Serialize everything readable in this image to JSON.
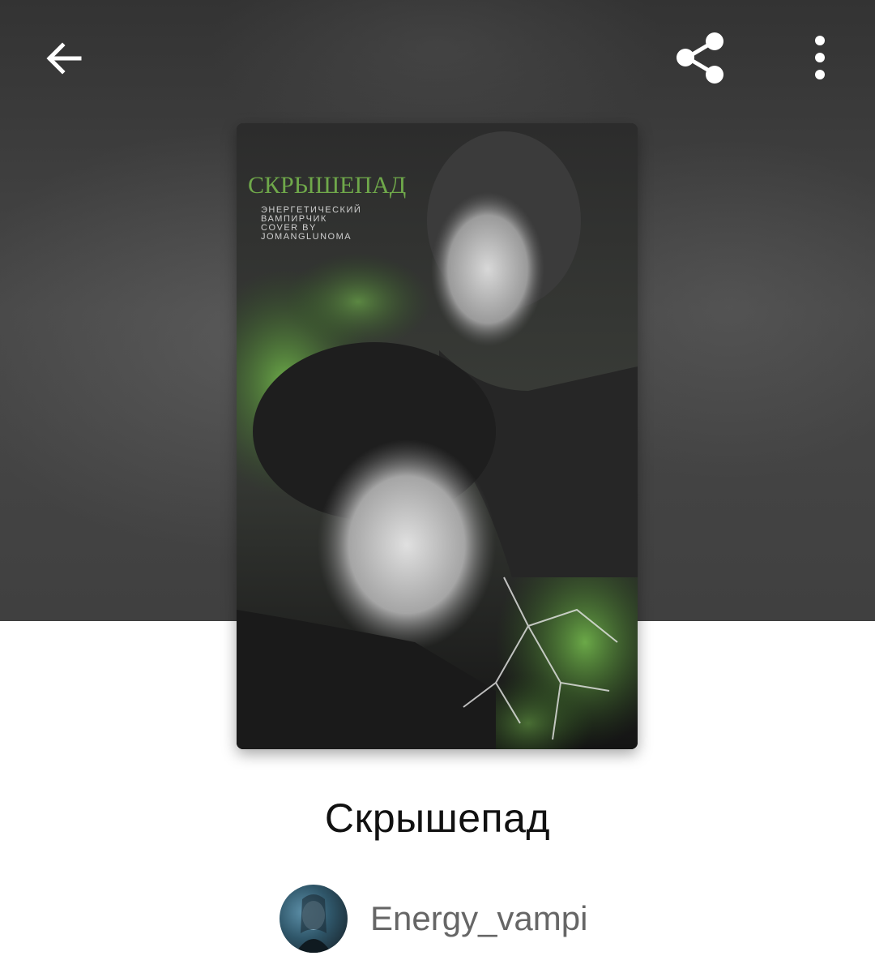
{
  "toolbar": {
    "back_icon": "arrow-left-icon",
    "share_icon": "share-icon",
    "more_icon": "more-vertical-icon"
  },
  "cover": {
    "title": "СКРЫШЕПАД",
    "lines": [
      "ЭНЕРГЕТИЧЕСКИЙ",
      "ВАМПИРЧИК",
      "COVER BY",
      "JOMANGLUNOMA"
    ],
    "accent_color": "#4f8a2f"
  },
  "book": {
    "title": "Скрышепад"
  },
  "author": {
    "name": "Energy_vampi"
  },
  "colors": {
    "header_bg": "#3f3f3f",
    "title_text": "#111111",
    "author_text": "#666666"
  }
}
